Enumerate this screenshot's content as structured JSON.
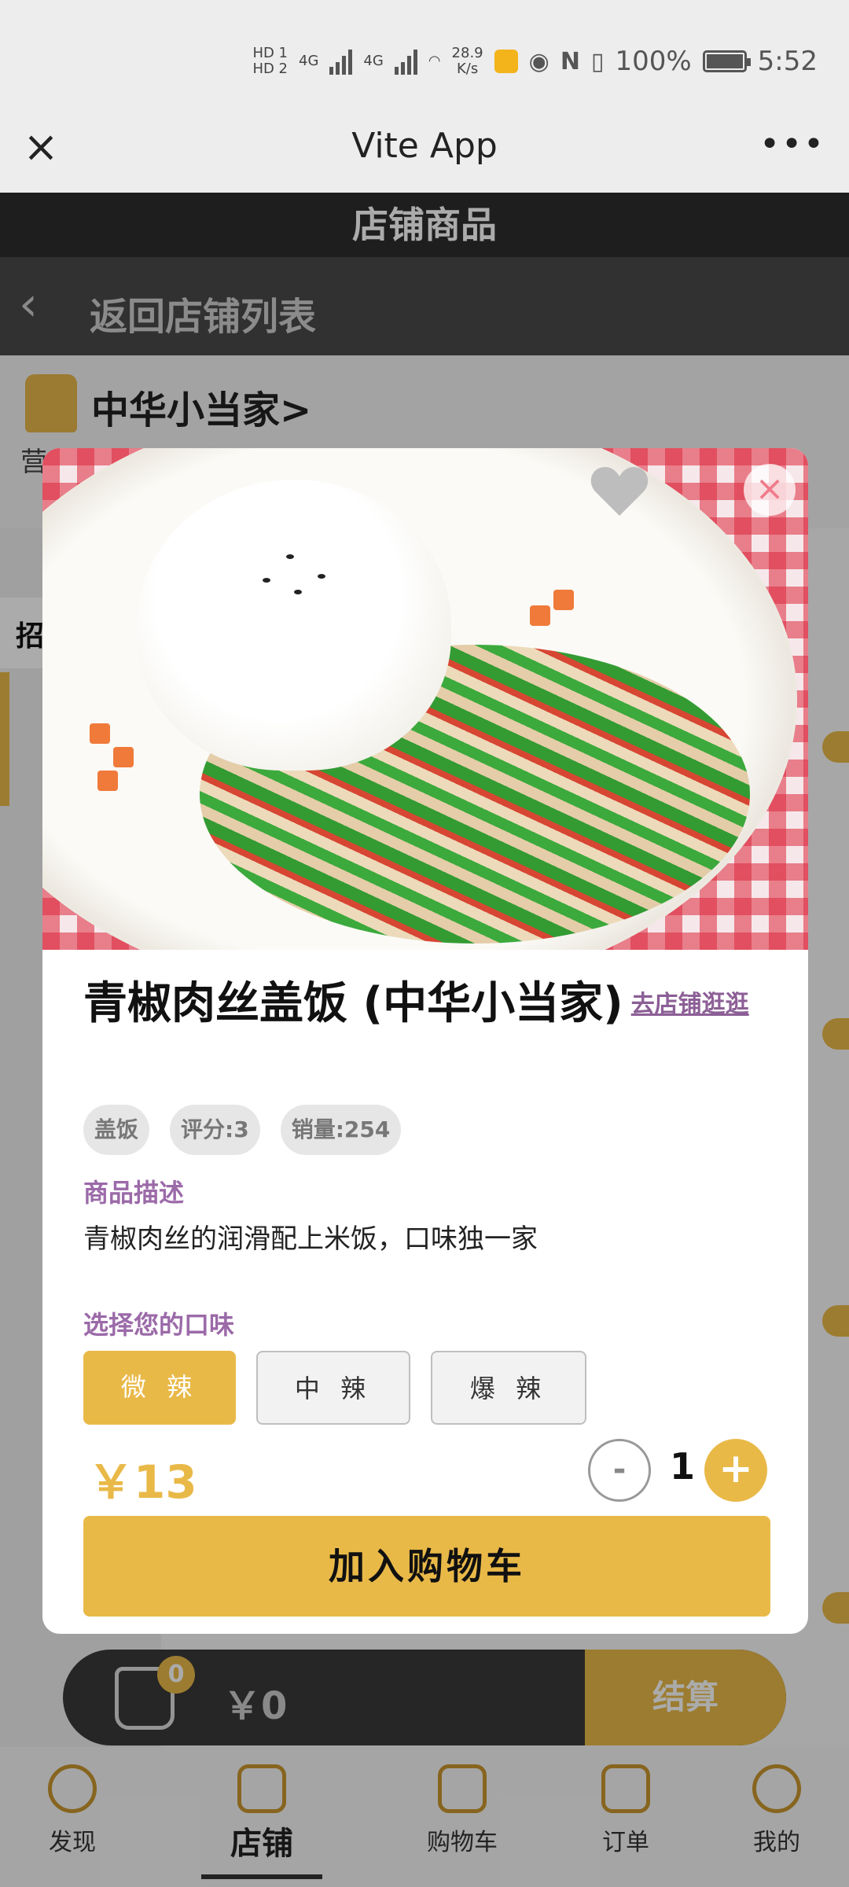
{
  "status_bar": {
    "hd1": "HD 1",
    "hd2": "HD 2",
    "sig1": "4G",
    "sig2": "4G",
    "speed_value": "28.9",
    "speed_unit": "K/s",
    "battery": "100%",
    "time": "5:52"
  },
  "window": {
    "title": "Vite App",
    "close_icon": "close-icon",
    "more_label": "•••"
  },
  "page": {
    "header": "店铺商品",
    "back_label": "返回店铺列表"
  },
  "store": {
    "name": "中华小当家>",
    "hours_partial": "营业时间 … 距离 …",
    "category_partial": "招"
  },
  "product": {
    "title": "青椒肉丝盖饭 (中华小当家)",
    "shop_link": "去店铺逛逛",
    "tags": [
      "盖饭",
      "评分:3",
      "销量:254"
    ],
    "desc_label": "商品描述",
    "description": "青椒肉丝的润滑配上米饭，口味独一家",
    "flavor_label": "选择您的口味",
    "flavors": [
      "微 辣",
      "中 辣",
      "爆 辣"
    ],
    "selected_flavor": "微 辣",
    "price": "￥13",
    "quantity": "1",
    "minus_label": "-",
    "plus_label": "+",
    "add_to_cart": "加入购物车"
  },
  "cart": {
    "count": "0",
    "total": "￥0",
    "checkout": "结算"
  },
  "tabs": [
    {
      "label": "发现",
      "icon": "discover-icon"
    },
    {
      "label": "店铺",
      "icon": "store-icon",
      "active": true
    },
    {
      "label": "购物车",
      "icon": "cart-icon"
    },
    {
      "label": "订单",
      "icon": "orders-icon"
    },
    {
      "label": "我的",
      "icon": "profile-icon"
    }
  ],
  "colors": {
    "accent": "#e9b948",
    "link": "#8c5f96",
    "header": "#2e2e2e"
  }
}
